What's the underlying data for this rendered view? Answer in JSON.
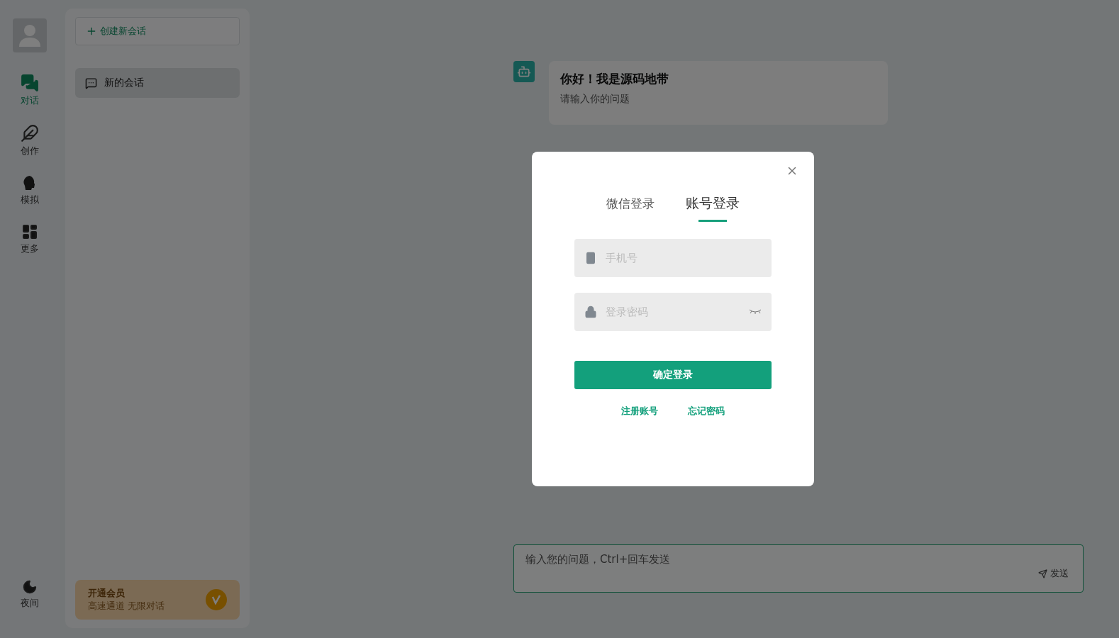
{
  "nav": {
    "items": [
      {
        "kind": "chat",
        "label": "对话",
        "selected": true
      },
      {
        "kind": "write",
        "label": "创作",
        "selected": false
      },
      {
        "kind": "role",
        "label": "模拟",
        "selected": false
      },
      {
        "kind": "more",
        "label": "更多",
        "selected": false
      }
    ],
    "theme_toggle": {
      "label": "夜间"
    }
  },
  "sidebar": {
    "new_chat": "创建新会话",
    "conversations": [
      {
        "title": "新的会话",
        "selected": true
      }
    ],
    "vip": {
      "title": "开通会员",
      "subtitle": "高速通道 无限对话"
    }
  },
  "chat": {
    "messages": [
      {
        "title": "你好！我是源码地带",
        "text": "请输入你的问题"
      }
    ],
    "input": {
      "placeholder": "输入您的问题，Ctrl+回车发送"
    },
    "send": "发送"
  },
  "login_dialog": {
    "tabs": [
      {
        "label": "微信登录",
        "selected": false
      },
      {
        "label": "账号登录",
        "selected": true
      }
    ],
    "fields": [
      {
        "kind": "phone",
        "placeholder": "手机号"
      },
      {
        "kind": "password",
        "placeholder": "登录密码"
      }
    ],
    "submit": "确定登录",
    "links": [
      "注册账号",
      "忘记密码"
    ]
  }
}
